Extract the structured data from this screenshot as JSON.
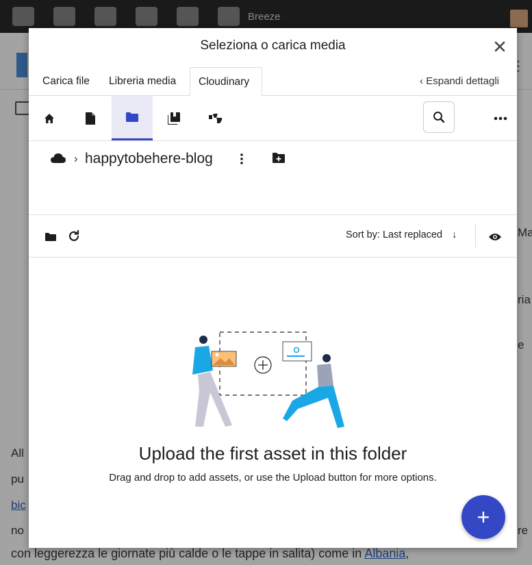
{
  "background": {
    "admin_bar_label": "Breeze",
    "right_fragments": [
      "Mai",
      "ria",
      "e"
    ],
    "left_fragments": [
      "All",
      "pu",
      "bic",
      "no"
    ],
    "right_bottom_fragment": "re",
    "bottom_text": "con leggerezza le giornate più calde o le tappe in salita) come in ",
    "bottom_link": "Albania",
    "bottom_trailing": ","
  },
  "modal": {
    "title": "Seleziona o carica media",
    "close_icon": "close-icon",
    "tabs": [
      {
        "label": "Carica file",
        "active": false
      },
      {
        "label": "Libreria media",
        "active": false
      },
      {
        "label": "Cloudinary",
        "active": true
      }
    ],
    "expand_details": "‹  Espandi dettagli",
    "toolbar": {
      "tools": [
        "home-icon",
        "document-icon",
        "folder-icon",
        "collections-icon",
        "dislike-icon"
      ],
      "active_tool": "folder-icon",
      "search_icon": "search-icon",
      "more_icon": "more-horizontal-icon"
    },
    "breadcrumb": {
      "root_icon": "cloud-icon",
      "separator": "›",
      "folder": "happytobehere-blog"
    },
    "list_toolbar": {
      "sort_label": "Sort by: Last replaced",
      "sort_arrow": "↓"
    },
    "empty_state": {
      "title": "Upload the first asset in this folder",
      "description": "Drag and drop to add assets, or use the Upload button for more options."
    },
    "fab_label": "+",
    "accent_color": "#3448c5"
  }
}
